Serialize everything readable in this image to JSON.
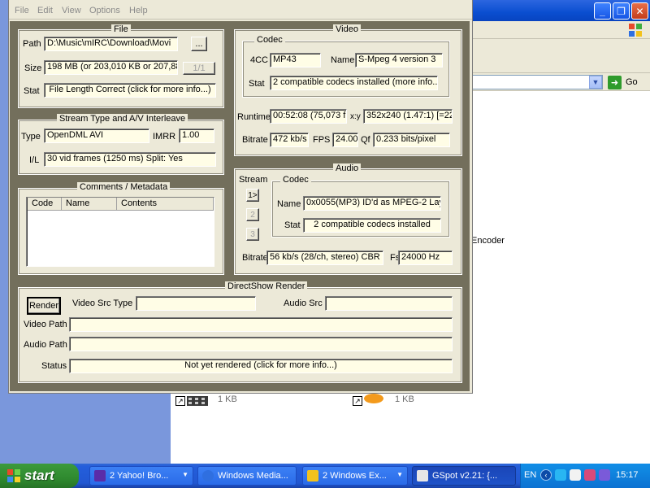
{
  "menu": [
    "File",
    "Edit",
    "View",
    "Options",
    "Help"
  ],
  "file_group": {
    "title": "File",
    "path_label": "Path",
    "path_value": "D:\\Music\\mIRC\\Download\\Movi",
    "browse_label": "...",
    "size_label": "Size",
    "size_value": "198 MB (or 203,010 KB or 207,88",
    "part_label": "1/1",
    "stat_label": "Stat",
    "stat_value": "File Length Correct (click for more info...)"
  },
  "stream_group": {
    "title": "Stream Type and A/V Interleave",
    "type_label": "Type",
    "type_value": "OpenDML AVI",
    "imrr_label": "IMRR",
    "imrr_value": "1.00",
    "il_label": "I/L",
    "il_value": "30 vid frames (1250 ms)  Split: Yes"
  },
  "comments_group": {
    "title": "Comments / Metadata",
    "columns": [
      "Code",
      "Name",
      "Contents"
    ]
  },
  "video_group": {
    "title": "Video",
    "codec_title": "Codec",
    "fourcc_label": "4CC",
    "fourcc_value": "MP43",
    "name_label": "Name",
    "name_value": "S-Mpeg 4 version 3",
    "stat_label": "Stat",
    "stat_value": "2 compatible codecs installed (more info...)",
    "runtime_label": "Runtime",
    "runtime_value": "00:52:08 (75,073 fr",
    "xy_label": "x:y",
    "xy_value": "352x240 (1.47:1) [=22",
    "bitrate_label": "Bitrate",
    "bitrate_value": "472 kb/s",
    "fps_label": "FPS",
    "fps_value": "24.00",
    "qf_label": "Qf",
    "qf_value": "0.233 bits/pixel"
  },
  "audio_group": {
    "title": "Audio",
    "stream_label": "Stream",
    "stream_buttons": [
      "1>",
      "2",
      "3"
    ],
    "codec_title": "Codec",
    "name_label": "Name",
    "name_value": "0x0055(MP3) ID'd as MPEG-2 Lay",
    "stat_label": "Stat",
    "stat_value": "2 compatible codecs installed",
    "bitrate_label": "Bitrate",
    "bitrate_value": "56 kb/s (28/ch, stereo) CBR",
    "fs_label": "Fs",
    "fs_value": "24000 Hz"
  },
  "render_group": {
    "title": "DirectShow Render",
    "render_button": "Render",
    "video_src_label": "Video Src Type",
    "audio_src_label": "Audio Src",
    "video_path_label": "Video Path",
    "audio_path_label": "Audio Path",
    "status_label": "Status",
    "status_value": "Not yet rendered (click for more info...)"
  },
  "background": {
    "go_label": "Go",
    "encoder_text": "Encoder",
    "file_sizes": [
      "1 KB",
      "1 KB"
    ]
  },
  "taskbar": {
    "start_label": "start",
    "items": [
      {
        "label": "2 Yahoo! Bro..."
      },
      {
        "label": "Windows Media..."
      },
      {
        "label": "2 Windows Ex..."
      },
      {
        "label": "GSpot v2.21: {..."
      }
    ],
    "lang": "EN",
    "clock": "15:17"
  },
  "colors": {
    "window_bg": "#ece9d8",
    "field_bg": "#fffde6",
    "taskbar_blue": "#245edb",
    "start_green": "#2f8a2f",
    "tray_blue": "#108ae2"
  }
}
